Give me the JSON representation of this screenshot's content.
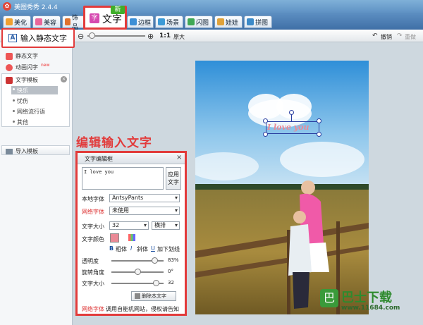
{
  "app": {
    "title": "美图秀秀 2.4.4"
  },
  "tabs": [
    {
      "label": "美化",
      "color": "#f0a030"
    },
    {
      "label": "美容",
      "color": "#e8679a"
    },
    {
      "label": "饰品",
      "color": "#e0722e"
    },
    {
      "label": "边框",
      "color": "#3d8fd6"
    },
    {
      "label": "场景",
      "color": "#3d9ad6"
    },
    {
      "label": "闪图",
      "color": "#40a856"
    },
    {
      "label": "娃娃",
      "color": "#e0a23a"
    },
    {
      "label": "拼图",
      "color": "#3c8ac8"
    }
  ],
  "active_tab": {
    "label": "文字",
    "badge": "新"
  },
  "toolbar": {
    "zoom_ratio": "1:1",
    "original_label": "原大",
    "undo_label": "撤销",
    "redo_label": "重做"
  },
  "sidebar": {
    "callout": "输入静态文字",
    "items": {
      "static_text": "静态文字",
      "animated_text": "动画闪字",
      "animated_badge": "new",
      "templates": "文字模板",
      "import_template": "导入模板"
    },
    "template_categories": [
      "快乐",
      "忧伤",
      "网络流行语",
      "其他"
    ],
    "selected_category": "快乐"
  },
  "overlay": {
    "edit_title": "编辑输入文字"
  },
  "dialog": {
    "title": "文字编辑框",
    "text_value": "I love you",
    "apply_label": "应用文字",
    "local_font_label": "本地字体",
    "local_font_value": "AntsyPants",
    "web_font_label": "网络字体",
    "web_font_value": "未使用",
    "font_size_label": "文字大小",
    "font_size_value": "32",
    "orientation_value": "横排",
    "color_label": "文字颜色",
    "text_color": "#ea8a96",
    "bold_label": "粗体",
    "italic_label": "斜体",
    "underline_label": "加下划线",
    "opacity_label": "透明度",
    "opacity_value": "83%",
    "opacity_level": 0.83,
    "rotation_label": "旋转角度",
    "rotation_value": "0°",
    "size_label": "文字大小",
    "size_value": "32",
    "delete_label": "删除本文字",
    "footer_label": "网络字体",
    "footer_text": "调用自能机网站，侵权请告知"
  },
  "photo": {
    "overlay_text": "I love you"
  },
  "watermark": {
    "brand": "巴士下载",
    "url": "www.11684.com"
  }
}
